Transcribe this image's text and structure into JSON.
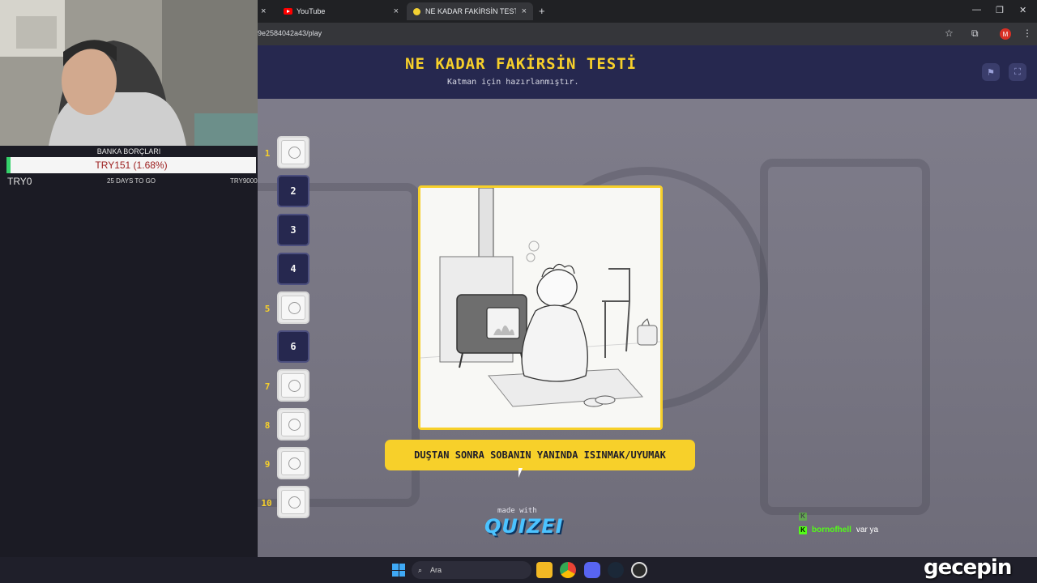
{
  "browser": {
    "tabs": [
      {
        "title": "YouTube",
        "active": false
      },
      {
        "title": "NE KADAR FAKİRSİN TESTİ - Ti",
        "active": true
      }
    ],
    "url": "9e2584042a43/play",
    "new_tab_symbol": "+",
    "close_symbol": "×",
    "profile_initial": "M",
    "icons": [
      "star-icon",
      "extensions-icon",
      "menu-icon",
      "minimize-icon",
      "restore-icon",
      "close-window-icon"
    ]
  },
  "quiz": {
    "title": "NE KADAR FAKİRSİN TESTİ",
    "subtitle": "Katman için hazırlanmıştır.",
    "answer": "DUŞTAN SONRA SOBANIN YANINDA ISINMAK/UYUMAK",
    "made_with": "made with",
    "brand": "QUIZEI",
    "questions": [
      {
        "number": "1",
        "label": "",
        "has_image": true
      },
      {
        "number": "",
        "label": "2",
        "has_image": false
      },
      {
        "number": "",
        "label": "3",
        "has_image": false
      },
      {
        "number": "",
        "label": "4",
        "has_image": false
      },
      {
        "number": "5",
        "label": "",
        "has_image": true
      },
      {
        "number": "",
        "label": "6",
        "has_image": false
      },
      {
        "number": "7",
        "label": "",
        "has_image": true
      },
      {
        "number": "8",
        "label": "",
        "has_image": true
      },
      {
        "number": "9",
        "label": "",
        "has_image": true
      },
      {
        "number": "10",
        "label": "",
        "has_image": true
      }
    ]
  },
  "widget": {
    "title": "BANKA BORÇLARI",
    "value": "TRY151 (1.68%)",
    "progress_percent": 1.68,
    "min": "TRY0",
    "days": "25 DAYS TO GO",
    "max": "TRY9000"
  },
  "chat": [
    {
      "user": "",
      "message": "",
      "faded": true
    },
    {
      "user": "bornofhell",
      "message": "var ya",
      "faded": false
    }
  ],
  "taskbar": {
    "search_placeholder": "Ara"
  },
  "watermark": "gecepin",
  "colors": {
    "accent_yellow": "#f7d02a",
    "header_navy": "#26284f",
    "kick_green": "#53fc18"
  }
}
